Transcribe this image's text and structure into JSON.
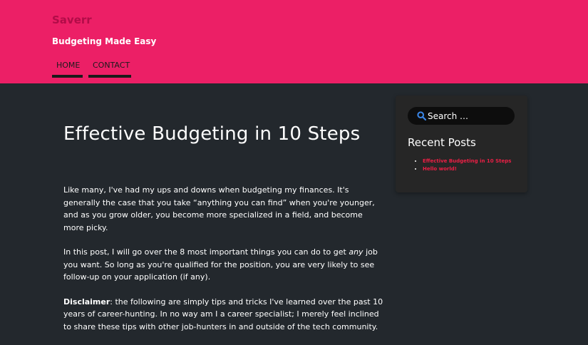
{
  "header": {
    "site_title": "Saverr",
    "site_description": "Budgeting Made Easy",
    "nav": [
      {
        "label": "HOME"
      },
      {
        "label": "CONTACT"
      }
    ]
  },
  "post": {
    "title": "Effective Budgeting in 10 Steps",
    "paragraphs": {
      "p1": "Like many, I've had my ups and downs when budgeting my finances. It's generally the case that you take “anything you can find” when you're younger, and as you grow older, you become more specialized in a field, and become more picky.",
      "p2_before": "In this post, I will go over the 8 most important things you can do to get ",
      "p2_emphasis": "any",
      "p2_after": " job you want. So long as you're qualified for the position, you are very likely to see follow-up on your application (if any).",
      "p3_label": "Disclaimer",
      "p3_text": ": the following are simply tips and tricks I've learned over the past 10 years of career-hunting. In no way am I a career specialist; I merely feel inclined to share these tips with other job-hunters in and outside of the tech community."
    }
  },
  "sidebar": {
    "search": {
      "placeholder": "Search …",
      "value": ""
    },
    "recent_posts_title": "Recent Posts",
    "recent_posts": [
      {
        "label": "Effective Budgeting in 10 Steps"
      },
      {
        "label": "Hello world!"
      }
    ]
  },
  "colors": {
    "header_bg": "#ec1f66",
    "page_bg": "#23282d",
    "widget_bg": "#262626",
    "link": "#ec1f45",
    "search_icon": "#3a86e8"
  },
  "icons": {
    "search": "search-icon"
  }
}
